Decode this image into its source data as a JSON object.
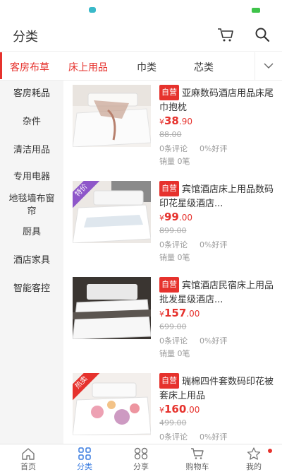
{
  "header": {
    "title": "分类"
  },
  "tabs": [
    {
      "label": "客房布草"
    },
    {
      "label": "床上用品"
    },
    {
      "label": "巾类"
    },
    {
      "label": "芯类"
    }
  ],
  "sidebar": {
    "items": [
      {
        "label": "客房耗品"
      },
      {
        "label": "杂件"
      },
      {
        "label": "清洁用品"
      },
      {
        "label": "专用电器"
      },
      {
        "label": "地毯墙布窗帘"
      },
      {
        "label": "厨具"
      },
      {
        "label": "酒店家具"
      },
      {
        "label": "智能客控"
      }
    ]
  },
  "products": [
    {
      "badge": "自营",
      "name": "亚麻数码酒店用品床尾巾抱枕",
      "currency": "¥",
      "price_int": "38",
      "price_dec": ".90",
      "old_price": "88.00",
      "comments": "0条评论",
      "rating": "0%好评",
      "sales": "销量 0笔",
      "ribbon": ""
    },
    {
      "badge": "自营",
      "name": "宾馆酒店床上用品数码印花星级酒店...",
      "currency": "¥",
      "price_int": "99",
      "price_dec": ".00",
      "old_price": "899.00",
      "comments": "0条评论",
      "rating": "0%好评",
      "sales": "销量 0笔",
      "ribbon": "特价"
    },
    {
      "badge": "自营",
      "name": "宾馆酒店民宿床上用品批发星级酒店...",
      "currency": "¥",
      "price_int": "157",
      "price_dec": ".00",
      "old_price": "699.00",
      "comments": "0条评论",
      "rating": "0%好评",
      "sales": "销量 0笔",
      "ribbon": ""
    },
    {
      "badge": "自营",
      "name": "瑞棉四件套数码印花被套床上用品",
      "currency": "¥",
      "price_int": "160",
      "price_dec": ".00",
      "old_price": "499.00",
      "comments": "0条评论",
      "rating": "0%好评",
      "sales": "",
      "ribbon": "热卖"
    }
  ],
  "bottom_nav": [
    {
      "label": "首页",
      "icon": "home-icon"
    },
    {
      "label": "分类",
      "icon": "grid-icon"
    },
    {
      "label": "分享",
      "icon": "share-icon"
    },
    {
      "label": "购物车",
      "icon": "cart-icon"
    },
    {
      "label": "我的",
      "icon": "star-icon"
    }
  ],
  "colors": {
    "accent": "#e6322d",
    "nav_active": "#3b7de0",
    "ribbon_purple": "#8e57c9"
  }
}
